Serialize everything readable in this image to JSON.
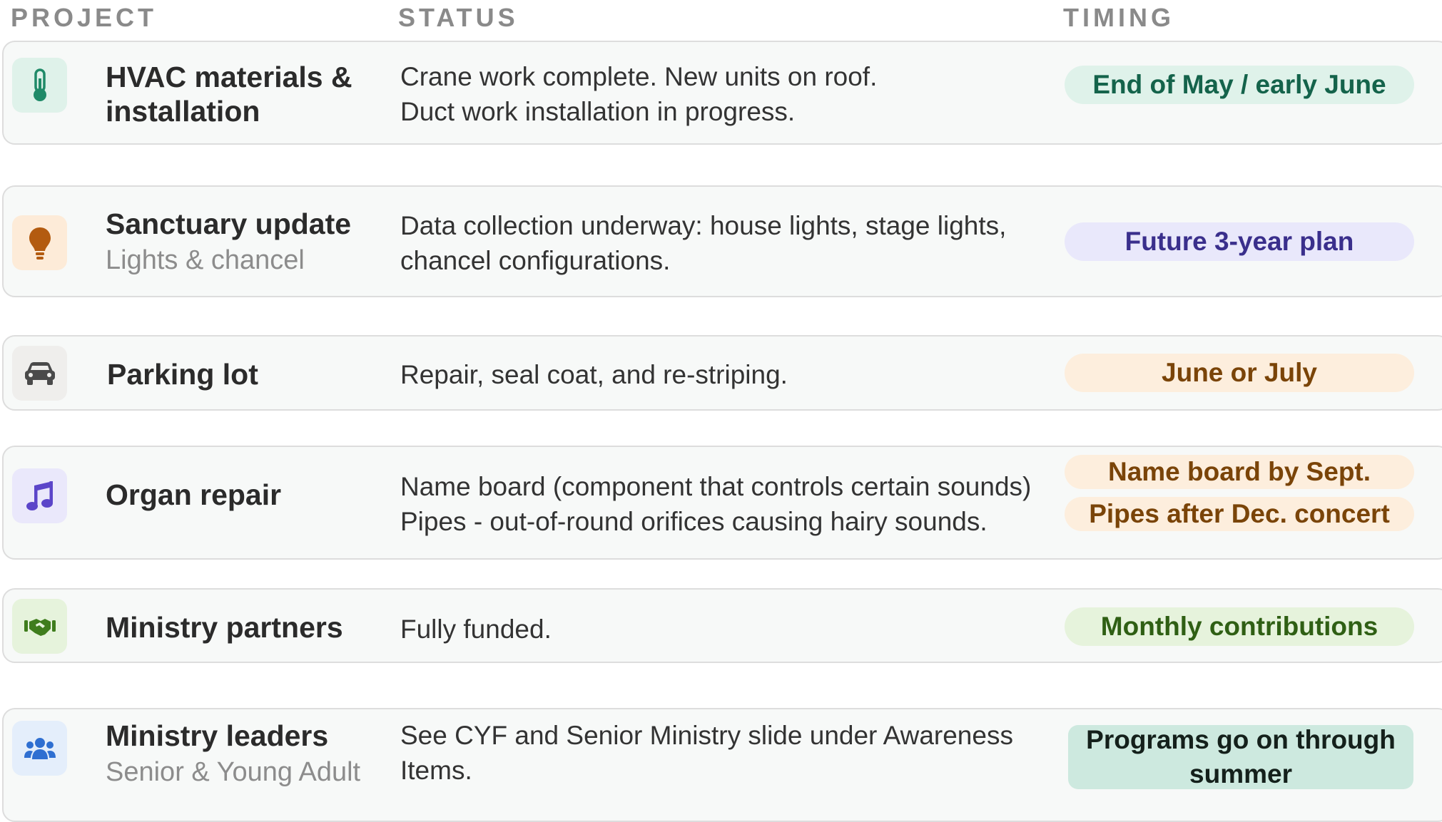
{
  "headers": {
    "project": "PROJECT",
    "status": "STATUS",
    "timing": "TIMING"
  },
  "rows": [
    {
      "icon": "thermometer-icon",
      "title": "HVAC materials & installation",
      "subtitle": "",
      "status": [
        "Crane work complete. New units on roof.",
        "Duct work installation in progress."
      ],
      "timing": [
        "End of May / early June"
      ],
      "icon_bg": "#dff2ea",
      "icon_color": "#1f8a68",
      "pill_bg": "#dff2ea",
      "pill_color": "#14634b"
    },
    {
      "icon": "lightbulb-icon",
      "title": "Sanctuary update",
      "subtitle": "Lights & chancel",
      "status": [
        "Data collection underway: house lights, stage lights,",
        "chancel configurations."
      ],
      "timing": [
        "Future 3-year plan"
      ],
      "icon_bg": "#fdebd8",
      "icon_color": "#b35b10",
      "pill_bg": "#e9e8fb",
      "pill_color": "#3a2f8c"
    },
    {
      "icon": "car-icon",
      "title": "Parking lot",
      "subtitle": "",
      "status": [
        "Repair, seal coat, and re-striping."
      ],
      "timing": [
        "June or July"
      ],
      "icon_bg": "#efeeec",
      "icon_color": "#4a4a4a",
      "pill_bg": "#fdeedd",
      "pill_color": "#7a4408"
    },
    {
      "icon": "music-note-icon",
      "title": "Organ repair",
      "subtitle": "",
      "status": [
        "Name board (component that controls certain sounds)",
        "Pipes - out-of-round orifices causing hairy sounds."
      ],
      "timing": [
        "Name board by Sept.",
        "Pipes after Dec. concert"
      ],
      "icon_bg": "#eae8fb",
      "icon_color": "#5b45c9",
      "pill_bg": "#fdeedd",
      "pill_color": "#7a4408"
    },
    {
      "icon": "handshake-icon",
      "title": "Ministry partners",
      "subtitle": "",
      "status": [
        "Fully funded."
      ],
      "timing": [
        "Monthly contributions"
      ],
      "icon_bg": "#e6f3dc",
      "icon_color": "#3f7d1d",
      "pill_bg": "#e6f3dc",
      "pill_color": "#2f5f14"
    },
    {
      "icon": "users-icon",
      "title": "Ministry leaders",
      "subtitle": "Senior & Young Adult",
      "status": [
        "See CYF and Senior Ministry slide under Awareness",
        "Items."
      ],
      "timing": [
        "Programs go on through summer"
      ],
      "icon_bg": "#e4eefb",
      "icon_color": "#2f6fd1",
      "pill_bg": "#cde9df",
      "pill_color": "#14201b"
    }
  ]
}
